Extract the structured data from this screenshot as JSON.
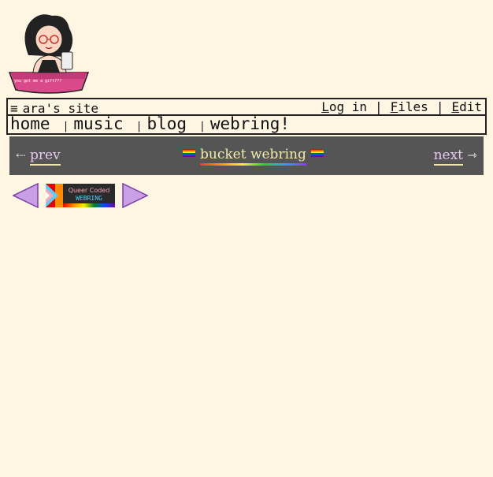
{
  "header": {
    "site_title": "ara's site",
    "menu_icon": "hamburger-icon",
    "badge_text": "you got me a gift???",
    "links": [
      {
        "accel": "L",
        "rest": "og in"
      },
      {
        "accel": "F",
        "rest": "iles"
      },
      {
        "accel": "E",
        "rest": "dit"
      }
    ],
    "separator": "|"
  },
  "nav": {
    "items": [
      "home",
      "music",
      "blog",
      "webring!"
    ],
    "separator": "|"
  },
  "webring": {
    "prev_arrow": "⇠",
    "prev_label": "prev",
    "title": "bucket webring",
    "next_label": "next",
    "next_arrow": "⇾"
  },
  "queer_webring": {
    "banner_line1": "Queer Coded",
    "banner_line2": "WEBRING"
  },
  "colors": {
    "background": "#fef5e3",
    "webring_bg": "#555555",
    "link_color": "#e7c9f0",
    "title_color": "#f3ecb0"
  }
}
